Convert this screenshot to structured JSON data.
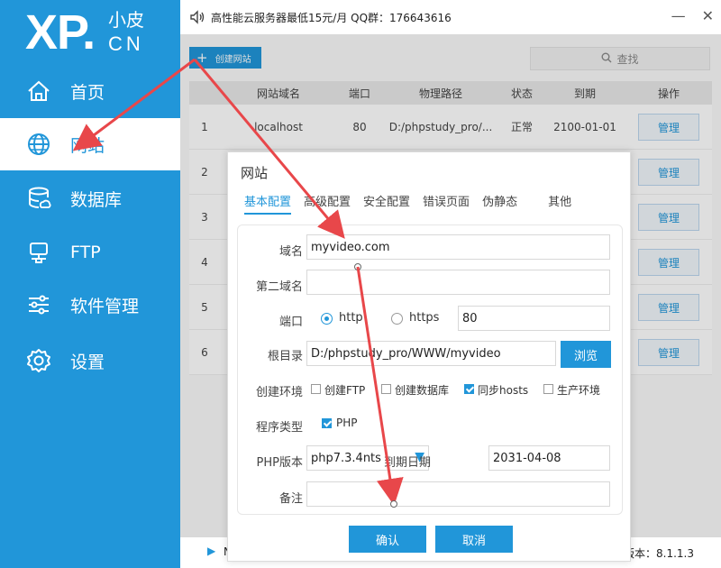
{
  "brand": {
    "logo_main": "XP.",
    "logo_cn": "小皮",
    "logo_sub": "CN"
  },
  "sidebar": {
    "items": [
      {
        "label": "首页",
        "icon": "home-icon"
      },
      {
        "label": "网站",
        "icon": "globe-icon",
        "active": true
      },
      {
        "label": "数据库",
        "icon": "database-icon"
      },
      {
        "label": "FTP",
        "icon": "ftp-icon"
      },
      {
        "label": "软件管理",
        "icon": "sliders-icon"
      },
      {
        "label": "设置",
        "icon": "gear-icon"
      }
    ]
  },
  "topbar": {
    "announcement": "高性能云服务器最低15元/月  QQ群：176643616"
  },
  "toolbar": {
    "create_label": "创建网站",
    "search_placeholder": "查找"
  },
  "table": {
    "headers": [
      "网站域名",
      "端口",
      "物理路径",
      "状态",
      "到期",
      "操作"
    ],
    "rows": [
      {
        "id": "1",
        "domain": "localhost",
        "port": "80",
        "path": "D:/phpstudy_pro/...",
        "status": "正常",
        "expire": "2100-01-01",
        "action": "管理"
      },
      {
        "id": "2",
        "action": "管理"
      },
      {
        "id": "3",
        "action": "管理"
      },
      {
        "id": "4",
        "action": "管理"
      },
      {
        "id": "5",
        "action": "管理"
      },
      {
        "id": "6",
        "action": "管理"
      }
    ]
  },
  "footer": {
    "left_text": "N",
    "version": "版本：8.1.1.3"
  },
  "modal": {
    "title": "网站",
    "tabs": [
      "基本配置",
      "高级配置",
      "安全配置",
      "错误页面",
      "伪静态",
      "其他"
    ],
    "active_tab": "基本配置",
    "form": {
      "domain_label": "域名",
      "domain_value": "myvideo.com",
      "second_domain_label": "第二域名",
      "second_domain_value": "",
      "port_label": "端口",
      "http_label": "http",
      "https_label": "https",
      "port_value": "80",
      "root_label": "根目录",
      "root_value": "D:/phpstudy_pro/WWW/myvideo",
      "browse_label": "浏览",
      "env_label": "创建环境",
      "env_options": [
        {
          "label": "创建FTP",
          "checked": false
        },
        {
          "label": "创建数据库",
          "checked": false
        },
        {
          "label": "同步hosts",
          "checked": true
        },
        {
          "label": "生产环境",
          "checked": false
        }
      ],
      "program_label": "程序类型",
      "program_option": "PHP",
      "php_label": "PHP版本",
      "php_value": "php7.3.4nts",
      "expire_label": "到期日期",
      "expire_value": "2031-04-08",
      "note_label": "备注",
      "note_value": ""
    },
    "confirm_label": "确认",
    "cancel_label": "取消"
  },
  "colors": {
    "brand": "#2196d9",
    "arrow": "#e8474a"
  }
}
